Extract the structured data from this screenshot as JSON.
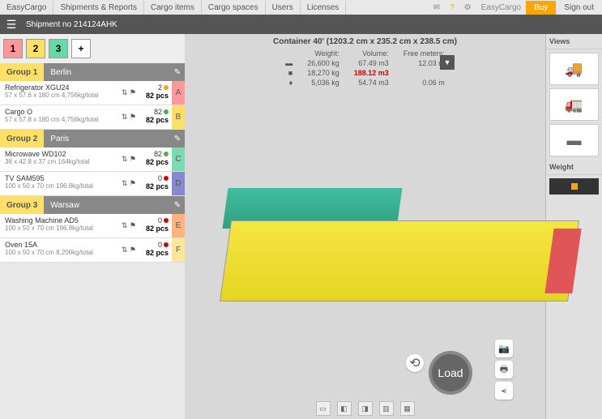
{
  "topbar": {
    "tabs": [
      "EasyCargo",
      "Shipments & Reports",
      "Cargo items",
      "Cargo spaces",
      "Users",
      "Licenses"
    ],
    "app_link": "EasyCargo",
    "buy": "Buy",
    "signout": "Sign out"
  },
  "shipment": {
    "title": "Shipment no 214124AHK"
  },
  "num_tabs": [
    "1",
    "2",
    "3",
    "+"
  ],
  "groups": [
    {
      "label": "Group 1",
      "city": "Berlin",
      "items": [
        {
          "name": "Refrigerator XGU24",
          "dims": "57 x 57.6 x 180 cm 4,756kg/total",
          "top": "2",
          "dot": "#ffa500",
          "pcs": "82 pcs",
          "color": "#ff9999",
          "letter": "A"
        },
        {
          "name": "Cargo O",
          "dims": "57 x 57.8 x 180 cm 4,756kg/total",
          "top": "82",
          "dot": "#4caf50",
          "pcs": "82 pcs",
          "color": "#ffe066",
          "letter": "B"
        }
      ]
    },
    {
      "label": "Group 2",
      "city": "Paris",
      "items": [
        {
          "name": "Microwave WD102",
          "dims": "38 x 42.8 x 37 cm 164kg/total",
          "top": "82",
          "dot": "#4caf50",
          "pcs": "82 pcs",
          "color": "#7fd9b0",
          "letter": "C"
        },
        {
          "name": "TV SAM595",
          "dims": "100 x 50 x 70 cm 196.8kg/total",
          "top": "0",
          "dot": "#cc0000",
          "pcs": "82 pcs",
          "color": "#8888cc",
          "letter": "D"
        }
      ]
    },
    {
      "label": "Group 3",
      "city": "Warsaw",
      "items": [
        {
          "name": "Washing Machine AD5",
          "dims": "100 x 50 x 70 cm 196.8kg/total",
          "top": "0",
          "dot": "#cc0000",
          "pcs": "82 pcs",
          "color": "#ffb380",
          "letter": "E"
        },
        {
          "name": "Oven 15A",
          "dims": "100 x 50 x 70 cm 8,200kg/total",
          "top": "0",
          "dot": "#cc0000",
          "pcs": "82 pcs",
          "color": "#ffe699",
          "letter": "F"
        }
      ]
    }
  ],
  "container": {
    "title": "Container 40' (1203.2 cm x 235.2 cm x 238.5 cm)",
    "headers": {
      "weight": "Weight:",
      "volume": "Volume:",
      "free": "Free meters:"
    },
    "rows": [
      {
        "icon": "▬",
        "weight": "26,600 kg",
        "volume": "67.49 m3",
        "free": "12.03 m"
      },
      {
        "icon": "■",
        "weight": "18,270 kg",
        "volume": "188.12 m3",
        "free": "",
        "vol_red": true
      },
      {
        "icon": "♦",
        "weight": "5,036 kg",
        "volume": "54.74 m3",
        "free": "0.06 m"
      }
    ]
  },
  "right": {
    "views_label": "Views",
    "weight_label": "Weight"
  },
  "load_btn": "Load"
}
